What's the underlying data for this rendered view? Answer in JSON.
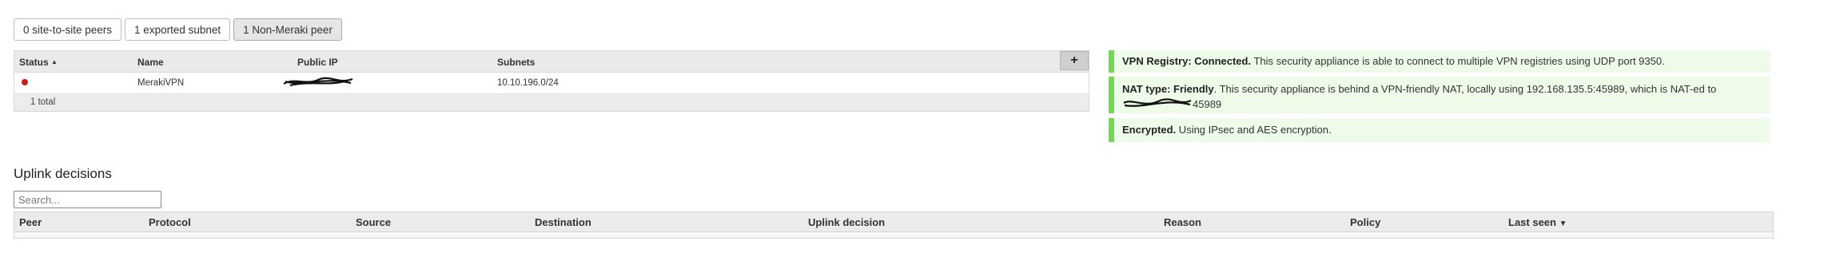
{
  "peer_tabs": [
    {
      "label": "0 site-to-site peers",
      "active": false
    },
    {
      "label": "1 exported subnet",
      "active": false
    },
    {
      "label": "1 Non-Meraki peer",
      "active": true
    }
  ],
  "peers_table": {
    "columns": {
      "status": "Status",
      "name": "Name",
      "public_ip": "Public IP",
      "subnets": "Subnets"
    },
    "sort_indicator": "▲",
    "add_label": "+",
    "rows": [
      {
        "status_color": "#cc1a1a",
        "name": "MerakiVPN",
        "public_ip": "",
        "subnets": "10.10.196.0/24"
      }
    ],
    "footer": "1 total"
  },
  "status_notices": {
    "registry": {
      "title": "VPN Registry: Connected.",
      "text": " This security appliance is able to connect to multiple VPN registries using UDP port 9350."
    },
    "nat": {
      "title": "NAT type: Friendly",
      "text": ". This security appliance is behind a VPN-friendly NAT, locally using 192.168.135.5:45989, which is NAT-ed to",
      "text_line2": "45989"
    },
    "encryption": {
      "title": "Encrypted.",
      "text": " Using IPsec and AES encryption."
    },
    "accent_color": "#77d55a"
  },
  "uplink": {
    "title": "Uplink decisions",
    "search_placeholder": "Search...",
    "columns": {
      "peer": "Peer",
      "protocol": "Protocol",
      "source": "Source",
      "destination": "Destination",
      "uplink_decision": "Uplink decision",
      "reason": "Reason",
      "policy": "Policy",
      "last_seen": "Last seen"
    },
    "sort_indicator": "▼"
  }
}
